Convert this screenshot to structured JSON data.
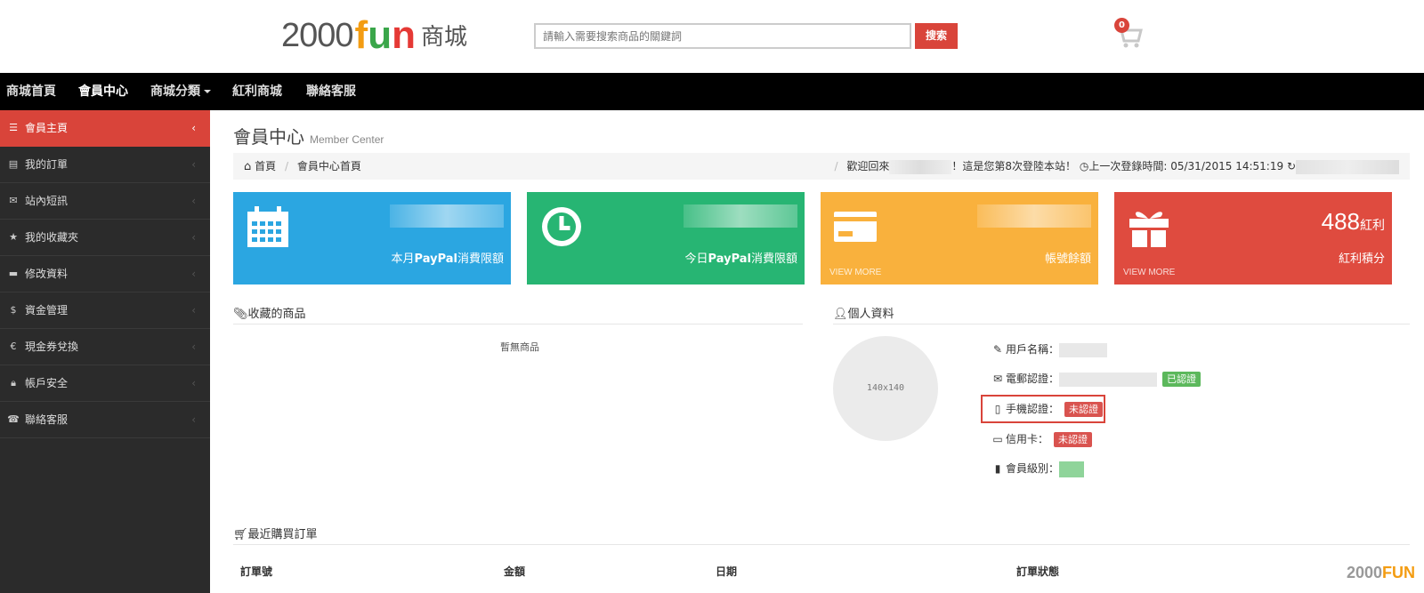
{
  "header": {
    "logo": {
      "num": "2000",
      "fun_f": "f",
      "fun_u": "u",
      "fun_n": "n",
      "suffix": "商城"
    },
    "search_placeholder": "請輸入需要搜索商品的關鍵詞",
    "search_button": "搜索",
    "cart_count": "0"
  },
  "nav": [
    {
      "label": "商城首頁",
      "active": false
    },
    {
      "label": "會員中心",
      "active": true
    },
    {
      "label": "商城分類",
      "active": false,
      "dropdown": true
    },
    {
      "label": "紅利商城",
      "active": false
    },
    {
      "label": "聯絡客服",
      "active": false
    }
  ],
  "sidebar": {
    "items": [
      {
        "label": "會員主頁",
        "icon": "list-icon",
        "active": true
      },
      {
        "label": "我的訂單",
        "icon": "order-icon"
      },
      {
        "label": "站內短訊",
        "icon": "envelope-icon"
      },
      {
        "label": "我的收藏夾",
        "icon": "star-icon"
      },
      {
        "label": "修改資料",
        "icon": "folder-icon"
      },
      {
        "label": "資金管理",
        "icon": "dollar-icon"
      },
      {
        "label": "現金券兌換",
        "icon": "euro-icon"
      },
      {
        "label": "帳戶安全",
        "icon": "lock-icon"
      },
      {
        "label": "聯絡客服",
        "icon": "phone-icon"
      }
    ]
  },
  "page": {
    "title": "會員中心",
    "subtitle": "Member Center",
    "breadcrumb": {
      "home": "首頁",
      "current": "會員中心首頁"
    },
    "welcome_prefix": "歡迎回來",
    "welcome_suffix": "！這是您第8次登陸本站！",
    "last_login_label": "上一次登錄時間: 05/31/2015 14:51:19"
  },
  "tiles": [
    {
      "label_pre": "本月",
      "label_bold": "PayPal",
      "label_post": "消費限額",
      "color": "#2ba6e1",
      "icon": "calendar-icon"
    },
    {
      "label_pre": "今日",
      "label_bold": "PayPal",
      "label_post": "消費限額",
      "color": "#27b573",
      "icon": "clock-icon"
    },
    {
      "label": "帳號餘額",
      "more": "VIEW MORE",
      "color": "#f9b13d",
      "icon": "credit-card-icon"
    },
    {
      "value": "488",
      "unit": "紅利",
      "label": "紅利積分",
      "more": "VIEW MORE",
      "color": "#df4b3f",
      "icon": "gift-icon"
    }
  ],
  "favorites": {
    "title": "收藏的商品",
    "empty": "暫無商品"
  },
  "profile": {
    "title": "個人資料",
    "avatar_text": "140x140",
    "username_label": "用戶名稱：",
    "email_label": "電郵認證：",
    "email_status": "已認證",
    "phone_label": "手機認證：",
    "phone_status": "未認證",
    "card_label": "信用卡：",
    "card_status": "未認證",
    "level_label": "會員級別："
  },
  "orders": {
    "title": "最近購買訂單",
    "columns": [
      "訂單號",
      "金額",
      "日期",
      "訂單狀態"
    ]
  },
  "watermark": {
    "num": "2000",
    "fun": "FUN"
  }
}
